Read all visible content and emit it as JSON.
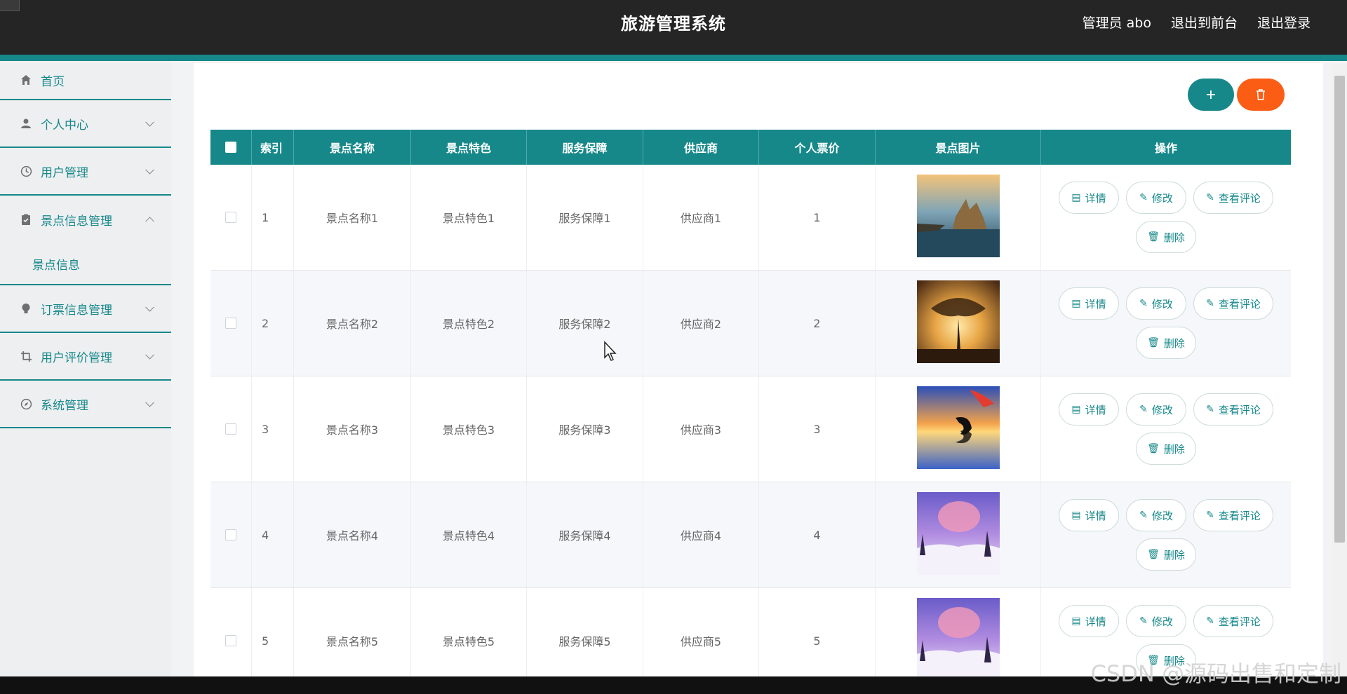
{
  "header": {
    "title": "旅游管理系统",
    "admin_label": "管理员 abo",
    "to_front_label": "退出到前台",
    "logout_label": "退出登录"
  },
  "sidebar": {
    "items": [
      {
        "label": "首页",
        "icon": "home-icon"
      },
      {
        "label": "个人中心",
        "icon": "user-icon"
      },
      {
        "label": "用户管理",
        "icon": "clock-icon"
      },
      {
        "label": "景点信息管理",
        "icon": "clipboard-icon",
        "open": true,
        "children": [
          {
            "label": "景点信息"
          }
        ]
      },
      {
        "label": "订票信息管理",
        "icon": "bulb-icon"
      },
      {
        "label": "用户评价管理",
        "icon": "crop-icon"
      },
      {
        "label": "系统管理",
        "icon": "compass-icon"
      }
    ]
  },
  "toolbar": {
    "add_icon": "plus-icon",
    "delete_icon": "trash-icon"
  },
  "table": {
    "columns": [
      "索引",
      "景点名称",
      "景点特色",
      "服务保障",
      "供应商",
      "个人票价",
      "景点图片",
      "操作"
    ],
    "rows": [
      {
        "index": "1",
        "name": "景点名称1",
        "feature": "景点特色1",
        "service": "服务保障1",
        "supplier": "供应商1",
        "price": "1",
        "image": "lake-castle-photo"
      },
      {
        "index": "2",
        "name": "景点名称2",
        "feature": "景点特色2",
        "service": "服务保障2",
        "supplier": "供应商2",
        "price": "2",
        "image": "tree-sunset-photo"
      },
      {
        "index": "3",
        "name": "景点名称3",
        "feature": "景点特色3",
        "service": "服务保障3",
        "supplier": "供应商3",
        "price": "3",
        "image": "dolphin-sunset-photo"
      },
      {
        "index": "4",
        "name": "景点名称4",
        "feature": "景点特色4",
        "service": "服务保障4",
        "supplier": "供应商4",
        "price": "4",
        "image": "purple-snow-photo"
      },
      {
        "index": "5",
        "name": "景点名称5",
        "feature": "景点特色5",
        "service": "服务保障5",
        "supplier": "供应商5",
        "price": "5",
        "image": "purple-snow-photo"
      }
    ],
    "actions": {
      "detail": "详情",
      "edit": "修改",
      "comments": "查看评论",
      "delete": "删除"
    }
  },
  "watermark": "CSDN @源码出售和定制",
  "colors": {
    "primary": "#17888a",
    "danger": "#fb5d14",
    "header_bg": "#252525"
  }
}
